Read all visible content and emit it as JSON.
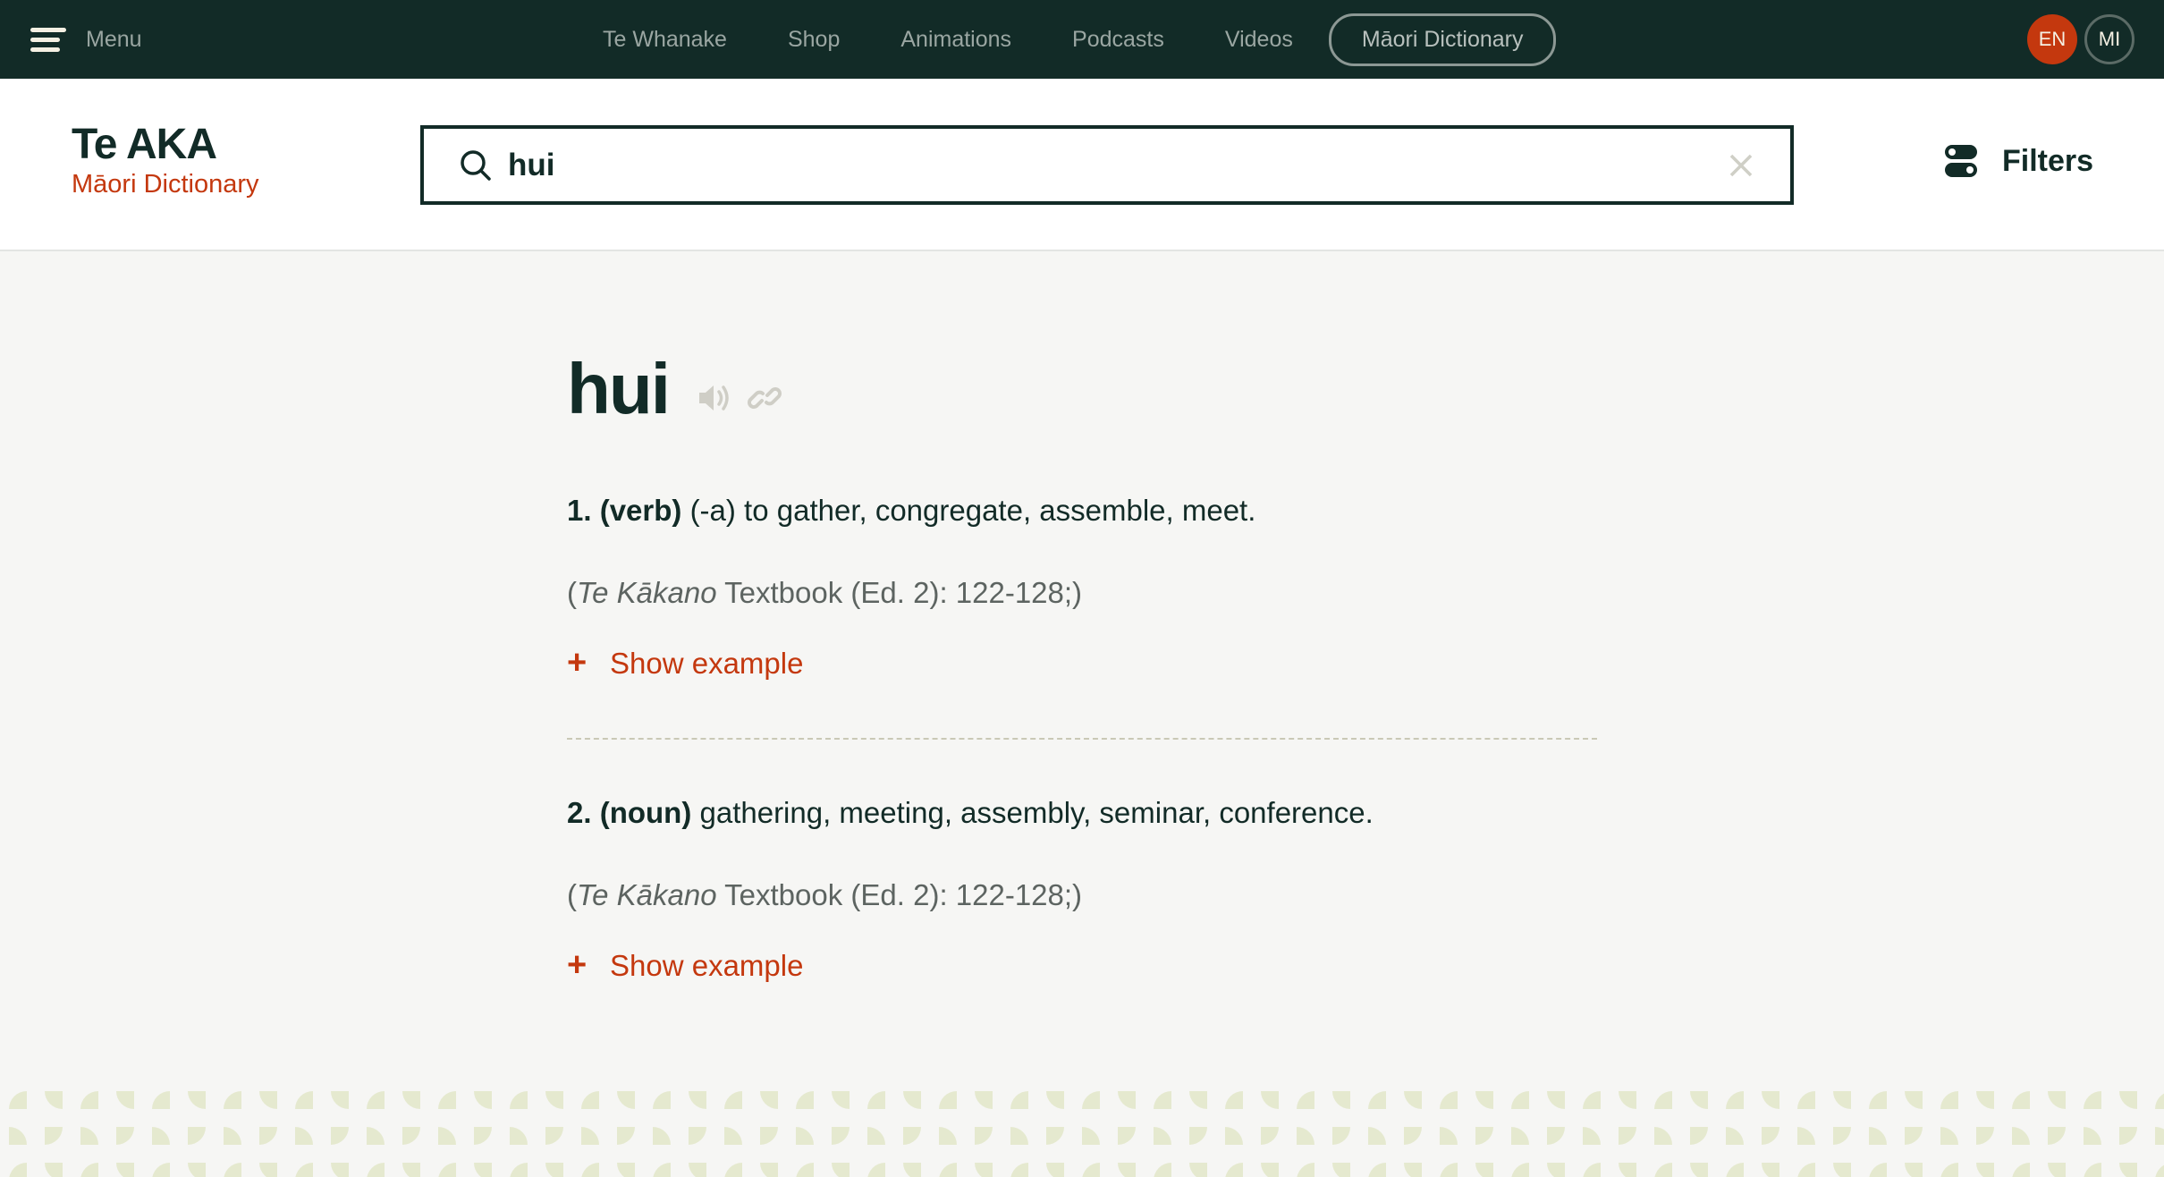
{
  "topbar": {
    "menu_label": "Menu",
    "nav": [
      "Te Whanake",
      "Shop",
      "Animations",
      "Podcasts",
      "Videos"
    ],
    "active_nav": "Māori Dictionary",
    "languages": [
      {
        "code": "EN",
        "active": true
      },
      {
        "code": "MI",
        "active": false
      }
    ]
  },
  "header": {
    "logo_title": "Te AKA",
    "logo_subtitle": "Māori Dictionary",
    "search_value": "hui",
    "filters_label": "Filters"
  },
  "entry": {
    "headword": "hui",
    "senses": [
      {
        "number": "1.",
        "pos": "(verb)",
        "definition": "(-a) to gather, congregate, assemble, meet.",
        "cite_open": "(",
        "cite_title": "Te Kākano",
        "cite_rest": "Textbook (Ed. 2): 122-128;)",
        "show_example": "Show example"
      },
      {
        "number": "2.",
        "pos": "(noun)",
        "definition": "gathering, meeting, assembly, seminar, conference.",
        "cite_open": "(",
        "cite_title": "Te Kākano",
        "cite_rest": "Textbook (Ed. 2): 122-128;)",
        "show_example": "Show example"
      }
    ]
  },
  "colors": {
    "brand_dark": "#122b27",
    "accent": "#c4380e",
    "pattern": "#e5e9cf"
  },
  "icons": {
    "menu": "hamburger-icon",
    "search": "search-icon",
    "clear": "close-icon",
    "filters": "toggle-filters-icon",
    "audio": "speaker-icon",
    "link": "link-icon",
    "expand": "plus-icon"
  }
}
